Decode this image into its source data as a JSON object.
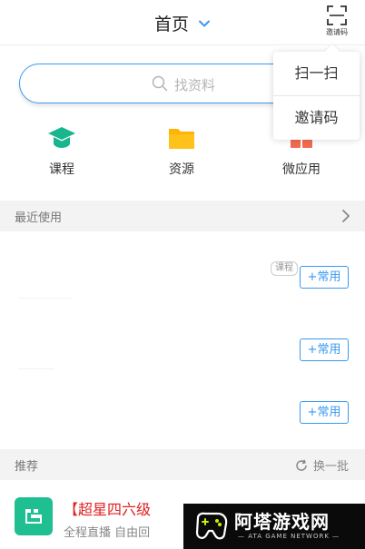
{
  "header": {
    "title": "首页",
    "invite_caption": "邀请码"
  },
  "search": {
    "placeholder": "找资料"
  },
  "quick_entries": [
    {
      "label": "课程",
      "icon": "graduation-cap-icon",
      "color": "#18b58e"
    },
    {
      "label": "资源",
      "icon": "folder-icon",
      "color": "#ffb400"
    },
    {
      "label": "微应用",
      "icon": "apps-icon",
      "color": "#f26b50"
    }
  ],
  "recent": {
    "title": "最近使用",
    "tag": "课程",
    "fav_label": "+常用"
  },
  "recommend": {
    "title": "推荐",
    "refresh_label": "换一批",
    "item": {
      "title": "【超星四六级",
      "subtitle": "全程直播  自由回"
    }
  },
  "popup_menu": {
    "items": [
      "扫一扫",
      "邀请码"
    ]
  },
  "watermark": {
    "text": "阿塔游戏网",
    "subtext": "— ATA GAME NETWORK —"
  },
  "colors": {
    "accent": "#3a99f0",
    "recommend_title": "#e02020"
  }
}
